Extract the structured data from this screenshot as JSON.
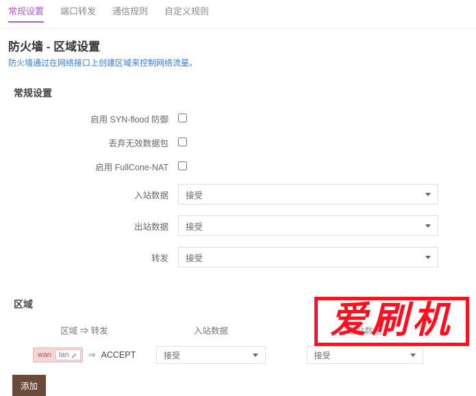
{
  "tabs": [
    {
      "label": "常规设置",
      "active": true
    },
    {
      "label": "端口转发",
      "active": false
    },
    {
      "label": "通信规则",
      "active": false
    },
    {
      "label": "自定义规则",
      "active": false
    }
  ],
  "page": {
    "title": "防火墙 - 区域设置",
    "desc": "防火墙通过在网络接口上创建区域来控制网络流量。"
  },
  "general": {
    "section_title": "常规设置",
    "rows": {
      "syn_flood": {
        "label": "启用 SYN-flood 防御",
        "checked": false
      },
      "drop_invalid": {
        "label": "丢弃无效数据包",
        "checked": false
      },
      "fullcone_nat": {
        "label": "启用 FullCone-NAT",
        "checked": false
      },
      "input": {
        "label": "入站数据",
        "value": "接受"
      },
      "output": {
        "label": "出站数据",
        "value": "接受"
      },
      "forward": {
        "label": "转发",
        "value": "接受"
      }
    }
  },
  "zones": {
    "section_title": "区域",
    "head": {
      "c1": "区域 ⇒ 转发",
      "c2": "入站数据",
      "c3": "出站数据"
    },
    "row1": {
      "source_tag": "wan",
      "target_tag": "lan",
      "arrow": "⇒",
      "dest": "ACCEPT",
      "input_value": "接受",
      "output_value": "接受"
    },
    "add_label": "添加"
  },
  "watermark": "爱刷机"
}
